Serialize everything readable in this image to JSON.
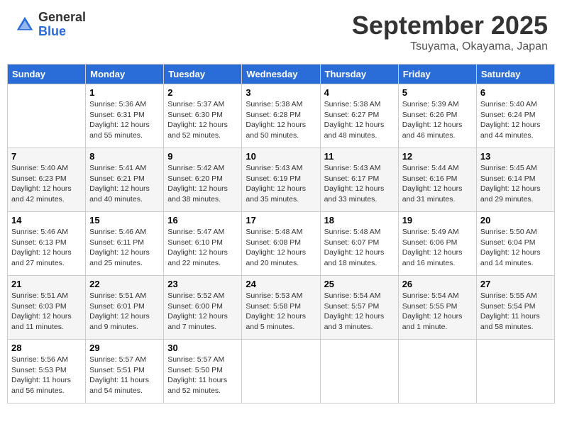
{
  "header": {
    "logo_general": "General",
    "logo_blue": "Blue",
    "month": "September 2025",
    "location": "Tsuyama, Okayama, Japan"
  },
  "days_of_week": [
    "Sunday",
    "Monday",
    "Tuesday",
    "Wednesday",
    "Thursday",
    "Friday",
    "Saturday"
  ],
  "weeks": [
    [
      {
        "day": "",
        "info": ""
      },
      {
        "day": "1",
        "info": "Sunrise: 5:36 AM\nSunset: 6:31 PM\nDaylight: 12 hours\nand 55 minutes."
      },
      {
        "day": "2",
        "info": "Sunrise: 5:37 AM\nSunset: 6:30 PM\nDaylight: 12 hours\nand 52 minutes."
      },
      {
        "day": "3",
        "info": "Sunrise: 5:38 AM\nSunset: 6:28 PM\nDaylight: 12 hours\nand 50 minutes."
      },
      {
        "day": "4",
        "info": "Sunrise: 5:38 AM\nSunset: 6:27 PM\nDaylight: 12 hours\nand 48 minutes."
      },
      {
        "day": "5",
        "info": "Sunrise: 5:39 AM\nSunset: 6:26 PM\nDaylight: 12 hours\nand 46 minutes."
      },
      {
        "day": "6",
        "info": "Sunrise: 5:40 AM\nSunset: 6:24 PM\nDaylight: 12 hours\nand 44 minutes."
      }
    ],
    [
      {
        "day": "7",
        "info": "Sunrise: 5:40 AM\nSunset: 6:23 PM\nDaylight: 12 hours\nand 42 minutes."
      },
      {
        "day": "8",
        "info": "Sunrise: 5:41 AM\nSunset: 6:21 PM\nDaylight: 12 hours\nand 40 minutes."
      },
      {
        "day": "9",
        "info": "Sunrise: 5:42 AM\nSunset: 6:20 PM\nDaylight: 12 hours\nand 38 minutes."
      },
      {
        "day": "10",
        "info": "Sunrise: 5:43 AM\nSunset: 6:19 PM\nDaylight: 12 hours\nand 35 minutes."
      },
      {
        "day": "11",
        "info": "Sunrise: 5:43 AM\nSunset: 6:17 PM\nDaylight: 12 hours\nand 33 minutes."
      },
      {
        "day": "12",
        "info": "Sunrise: 5:44 AM\nSunset: 6:16 PM\nDaylight: 12 hours\nand 31 minutes."
      },
      {
        "day": "13",
        "info": "Sunrise: 5:45 AM\nSunset: 6:14 PM\nDaylight: 12 hours\nand 29 minutes."
      }
    ],
    [
      {
        "day": "14",
        "info": "Sunrise: 5:46 AM\nSunset: 6:13 PM\nDaylight: 12 hours\nand 27 minutes."
      },
      {
        "day": "15",
        "info": "Sunrise: 5:46 AM\nSunset: 6:11 PM\nDaylight: 12 hours\nand 25 minutes."
      },
      {
        "day": "16",
        "info": "Sunrise: 5:47 AM\nSunset: 6:10 PM\nDaylight: 12 hours\nand 22 minutes."
      },
      {
        "day": "17",
        "info": "Sunrise: 5:48 AM\nSunset: 6:08 PM\nDaylight: 12 hours\nand 20 minutes."
      },
      {
        "day": "18",
        "info": "Sunrise: 5:48 AM\nSunset: 6:07 PM\nDaylight: 12 hours\nand 18 minutes."
      },
      {
        "day": "19",
        "info": "Sunrise: 5:49 AM\nSunset: 6:06 PM\nDaylight: 12 hours\nand 16 minutes."
      },
      {
        "day": "20",
        "info": "Sunrise: 5:50 AM\nSunset: 6:04 PM\nDaylight: 12 hours\nand 14 minutes."
      }
    ],
    [
      {
        "day": "21",
        "info": "Sunrise: 5:51 AM\nSunset: 6:03 PM\nDaylight: 12 hours\nand 11 minutes."
      },
      {
        "day": "22",
        "info": "Sunrise: 5:51 AM\nSunset: 6:01 PM\nDaylight: 12 hours\nand 9 minutes."
      },
      {
        "day": "23",
        "info": "Sunrise: 5:52 AM\nSunset: 6:00 PM\nDaylight: 12 hours\nand 7 minutes."
      },
      {
        "day": "24",
        "info": "Sunrise: 5:53 AM\nSunset: 5:58 PM\nDaylight: 12 hours\nand 5 minutes."
      },
      {
        "day": "25",
        "info": "Sunrise: 5:54 AM\nSunset: 5:57 PM\nDaylight: 12 hours\nand 3 minutes."
      },
      {
        "day": "26",
        "info": "Sunrise: 5:54 AM\nSunset: 5:55 PM\nDaylight: 12 hours\nand 1 minute."
      },
      {
        "day": "27",
        "info": "Sunrise: 5:55 AM\nSunset: 5:54 PM\nDaylight: 11 hours\nand 58 minutes."
      }
    ],
    [
      {
        "day": "28",
        "info": "Sunrise: 5:56 AM\nSunset: 5:53 PM\nDaylight: 11 hours\nand 56 minutes."
      },
      {
        "day": "29",
        "info": "Sunrise: 5:57 AM\nSunset: 5:51 PM\nDaylight: 11 hours\nand 54 minutes."
      },
      {
        "day": "30",
        "info": "Sunrise: 5:57 AM\nSunset: 5:50 PM\nDaylight: 11 hours\nand 52 minutes."
      },
      {
        "day": "",
        "info": ""
      },
      {
        "day": "",
        "info": ""
      },
      {
        "day": "",
        "info": ""
      },
      {
        "day": "",
        "info": ""
      }
    ]
  ]
}
